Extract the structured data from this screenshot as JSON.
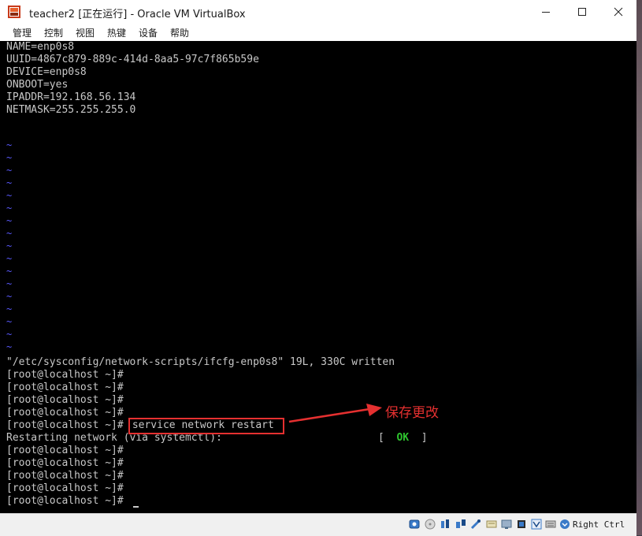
{
  "window": {
    "title": "teacher2 [正在运行] - Oracle VM VirtualBox",
    "menu": [
      "管理",
      "控制",
      "视图",
      "热键",
      "设备",
      "帮助"
    ]
  },
  "terminal": {
    "file_lines": [
      "NAME=enp0s8",
      "UUID=4867c879-889c-414d-8aa5-97c7f865b59e",
      "DEVICE=enp0s8",
      "ONBOOT=yes",
      "IPADDR=192.168.56.134",
      "NETMASK=255.255.255.0"
    ],
    "tilde_char": "~",
    "written_msg": "\"/etc/sysconfig/network-scripts/ifcfg-enp0s8\" 19L, 330C written",
    "prompt": "[root@localhost ~]#",
    "command": " service network restart",
    "restart_msg": "Restarting network (via systemctl):",
    "ok_open": "[  ",
    "ok_text": "OK",
    "ok_close": "  ]"
  },
  "annotation": {
    "label": "保存更改",
    "color": "#e53030"
  },
  "status": {
    "host_key": "Right Ctrl",
    "icons": [
      "hard-disk-icon",
      "optical-disk-icon",
      "usb-icon",
      "network-icon",
      "shared-folder-icon",
      "display-icon",
      "video-capture-icon",
      "cpu-icon",
      "mouse-integration-icon",
      "keyboard-icon",
      "arrow-down-icon"
    ]
  }
}
